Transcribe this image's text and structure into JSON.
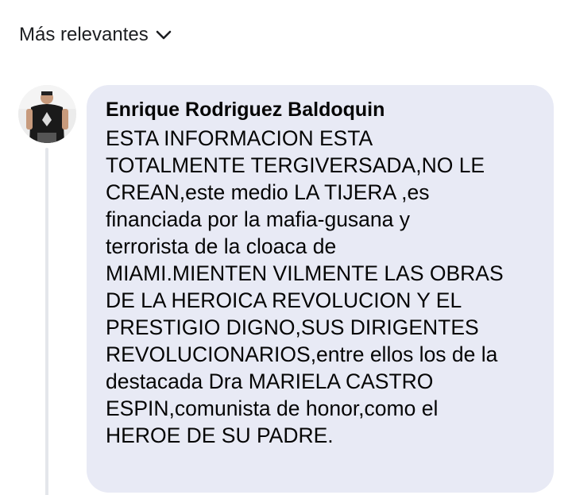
{
  "sort": {
    "label": "Más relevantes"
  },
  "comment": {
    "author": "Enrique Rodriguez Baldoquin",
    "lines": [
      "ESTA INFORMACION ESTA",
      "TOTALMENTE TERGIVERSADA,NO LE",
      "CREAN,este medio LA TIJERA ,es",
      "financiada por la mafia-gusana y",
      "terrorista de la cloaca de",
      "MIAMI.MIENTEN VILMENTE LAS OBRAS",
      "DE LA HEROICA REVOLUCION Y EL",
      "PRESTIGIO DIGNO,SUS DIRIGENTES",
      "REVOLUCIONARIOS,entre ellos los de la",
      "destacada Dra MARIELA CASTRO",
      "ESPIN,comunista de honor,como el",
      "HEROE DE SU PADRE."
    ]
  },
  "colors": {
    "bubble_bg": "#e8eaf5",
    "thread_line": "#e4e6eb",
    "text": "#050505"
  },
  "icons": {
    "sort_chevron": "chevron-down-icon"
  }
}
